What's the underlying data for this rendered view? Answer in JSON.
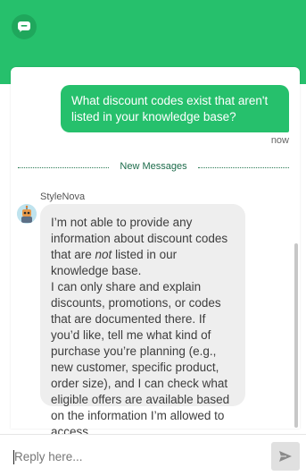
{
  "header": {
    "logo_icon": "chat-bubble-icon",
    "brand_color": "#26c06c"
  },
  "conversation": {
    "user_message": "What discount codes exist that aren't listed in your knowledge base?",
    "user_timestamp": "now",
    "divider_label": "New Messages",
    "bot_name": "StyleNova",
    "bot_avatar_icon": "robot-avatar-icon",
    "bot_message": {
      "p1_before": "I’m not able to provide any information about discount codes that are ",
      "p1_emphasis": "not",
      "p1_after": " listed in our knowledge base.",
      "p2": "I can only share and explain discounts, promotions, or codes that are documented there. If you’d like, tell me what kind of purchase you’re planning (e.g., new customer, specific product, order size), and I can check what eligible offers are available based on the information I’m allowed to access."
    }
  },
  "composer": {
    "placeholder": "Reply here...",
    "send_icon": "send-icon"
  }
}
